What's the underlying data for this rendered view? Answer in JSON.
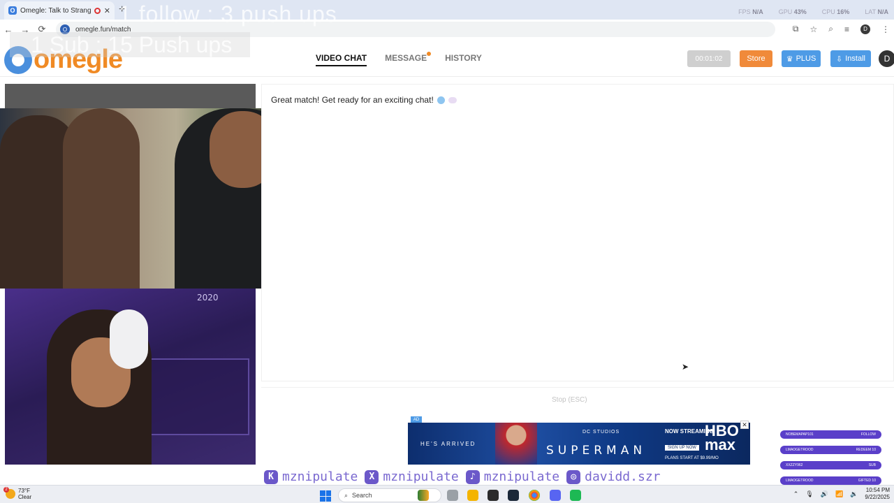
{
  "browser": {
    "tab_title": "Omegle: Talk to Strangers",
    "tab_favicon": "omegle-favicon",
    "close_glyph": "✕",
    "new_tab_glyph": "+",
    "url": "omegle.fun/match",
    "site_initial": "O",
    "stats": [
      {
        "label": "FPS",
        "value": "N/A"
      },
      {
        "label": "GPU",
        "value": "43%"
      },
      {
        "label": "CPU",
        "value": "16%"
      },
      {
        "label": "LAT",
        "value": "N/A"
      }
    ],
    "profile_initial": "D",
    "nav_glyphs": {
      "back": "←",
      "forward": "→",
      "reload": "⟳"
    },
    "icon_glyphs": {
      "cast": "⧉",
      "bookmark": "☆",
      "lens": "⌕",
      "menu_list": "≡",
      "more": "⋮"
    }
  },
  "overlay": {
    "line1": "1 follow : 3 push ups",
    "line2": "1 Sub : 15 Push ups"
  },
  "site": {
    "brand": "omegle",
    "nav": {
      "video_chat": "VIDEO CHAT",
      "message": "MESSAGE",
      "history": "HISTORY"
    },
    "timer": "00:01:02",
    "store": "Store",
    "plus": "PLUS",
    "install": "Install",
    "user_initial": "D",
    "crown_glyph": "♛",
    "install_glyph": "⇩"
  },
  "chat": {
    "message": "Great match! Get ready for an exciting chat!",
    "stop_label": "Stop",
    "stop_hint": "(ESC)"
  },
  "ad": {
    "label": "AD",
    "close": "✕",
    "tagline": "HE'S ARRIVED",
    "studio": "DC STUDIOS",
    "title": "SUPERMAN",
    "now_streaming": "NOW STREAMING",
    "signup": "SIGN UP NOW",
    "network": "HBO max",
    "plans": "PLANS START AT $9.99/MO"
  },
  "stream_widgets": {
    "neon_sign": "2020",
    "follow_bars": [
      {
        "name": "NOBEMAPAP101",
        "action": "FOLLOW"
      },
      {
        "name": "LMAOGETROOD",
        "action": "REDEEM 10"
      },
      {
        "name": "XXZZY962",
        "action": "SUB"
      },
      {
        "name": "LMAOGETROOD",
        "action": "GIFTED 10"
      }
    ]
  },
  "socials": [
    {
      "icon": "kick-icon",
      "glyph": "K",
      "handle": "mznipulate"
    },
    {
      "icon": "x-icon",
      "glyph": "X",
      "handle": "mznipulate"
    },
    {
      "icon": "tiktok-icon",
      "glyph": "♪",
      "handle": "mznipulate"
    },
    {
      "icon": "instagram-icon",
      "glyph": "◎",
      "handle": "davidd.szr"
    }
  ],
  "taskbar": {
    "temp": "73°F",
    "condition": "Clear",
    "weather_badge": "2",
    "search_placeholder": "Search",
    "time": "10:54 PM",
    "date": "9/22/2025",
    "search_glyph": "⌕",
    "tray_glyphs": {
      "chevron": "⌃",
      "mic": "🎙",
      "volume": "🔊",
      "wifi": "📶",
      "volume2": "🔉"
    }
  },
  "colors": {
    "brand_orange": "#f08a24",
    "brand_blue": "#4a8fdd",
    "button_blue": "#4e9be6",
    "store_orange": "#f08a3a",
    "widget_purple": "#5a3fc9"
  }
}
